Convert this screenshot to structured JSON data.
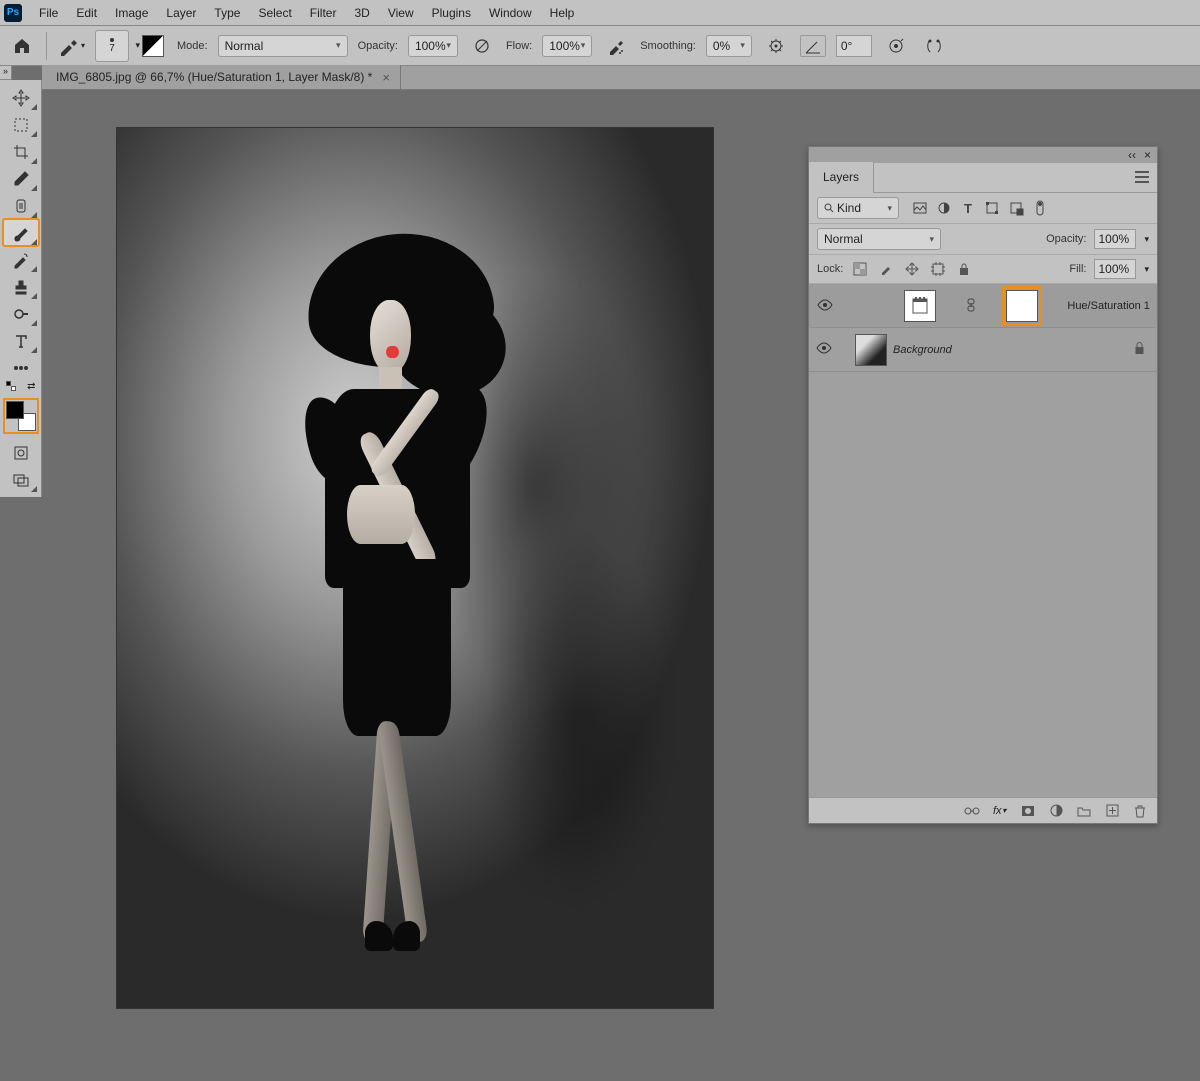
{
  "menu": {
    "items": [
      "File",
      "Edit",
      "Image",
      "Layer",
      "Type",
      "Select",
      "Filter",
      "3D",
      "View",
      "Plugins",
      "Window",
      "Help"
    ]
  },
  "options": {
    "brush_size": "7",
    "mode_label": "Mode:",
    "mode_value": "Normal",
    "opacity_label": "Opacity:",
    "opacity_value": "100%",
    "flow_label": "Flow:",
    "flow_value": "100%",
    "smoothing_label": "Smoothing:",
    "smoothing_value": "0%",
    "angle_value": "0°"
  },
  "document": {
    "tab_title": "IMG_6805.jpg @ 66,7% (Hue/Saturation 1, Layer Mask/8) *"
  },
  "layers_panel": {
    "title": "Layers",
    "filter_kind": "Kind",
    "blend_mode": "Normal",
    "opacity_label": "Opacity:",
    "opacity_value": "100%",
    "lock_label": "Lock:",
    "fill_label": "Fill:",
    "fill_value": "100%",
    "layers": [
      {
        "name": "Hue/Saturation 1",
        "selected": true,
        "mask_highlighted": true,
        "italic": false,
        "locked": false
      },
      {
        "name": "Background",
        "selected": false,
        "mask_highlighted": false,
        "italic": true,
        "locked": true
      }
    ]
  },
  "highlights": {
    "brush_tool": true,
    "color_swatches": true,
    "layer_mask": true
  }
}
